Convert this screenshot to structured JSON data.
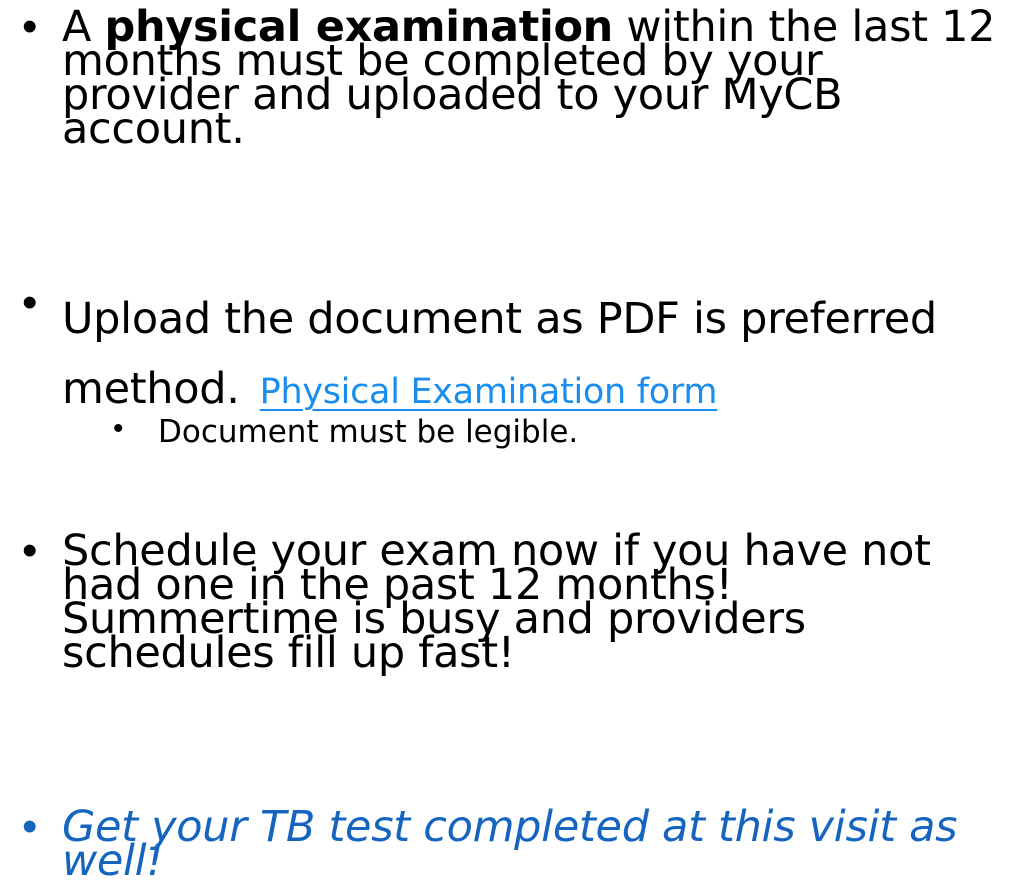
{
  "bullets": {
    "b1": {
      "prefix": "A ",
      "bold": "physical examination",
      "line1_rest": " within the last 12",
      "line2": "months must be completed by your",
      "line3": "provider and uploaded to your MyCB",
      "line4": "account."
    },
    "b2": {
      "line1": "Upload the document as PDF is preferred",
      "line2": "method.",
      "link_text": "Physical Examination form",
      "sub": "Document must be legible."
    },
    "b3": {
      "line1": "Schedule your exam now if you have not",
      "line2": "had one in the past 12 months!",
      "line3": "Summertime is busy and providers",
      "line4": "schedules fill up fast!"
    },
    "b4": {
      "line1": "Get your TB test completed at this visit as",
      "line2": "well!"
    }
  },
  "colors": {
    "link": "#1a8ef0",
    "emphasis": "#1565c0",
    "text": "#000000",
    "background": "#ffffff"
  },
  "bullet_glyph": "•"
}
